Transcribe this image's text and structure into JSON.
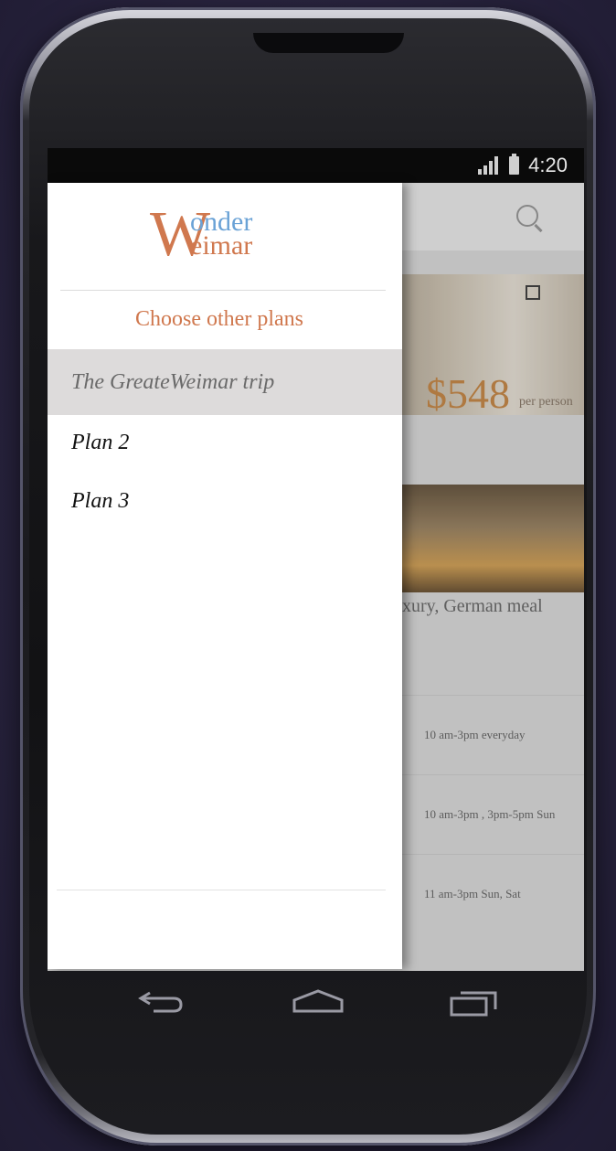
{
  "statusbar": {
    "time": "4:20"
  },
  "logo": {
    "big_letter": "W",
    "line1": "onder",
    "line2": "eimar"
  },
  "drawer": {
    "subtitle": "Choose other plans",
    "plans": [
      {
        "label": "The GreateWeimar trip",
        "selected": true
      },
      {
        "label": "Plan 2",
        "selected": false
      },
      {
        "label": "Plan 3",
        "selected": false
      }
    ]
  },
  "background_content": {
    "price": "$548",
    "per_person": "per person",
    "meal_text": "xury, German meal",
    "schedules": [
      "10 am-3pm everyday",
      "10 am-3pm , 3pm-5pm Sun",
      "11 am-3pm Sun, Sat"
    ]
  },
  "colors": {
    "accent_orange": "#d0784e",
    "accent_blue": "#6aa2d6"
  },
  "icons": [
    "signal-icon",
    "battery-icon",
    "search-icon",
    "edit-icon",
    "back-icon",
    "home-icon",
    "recent-apps-icon"
  ]
}
